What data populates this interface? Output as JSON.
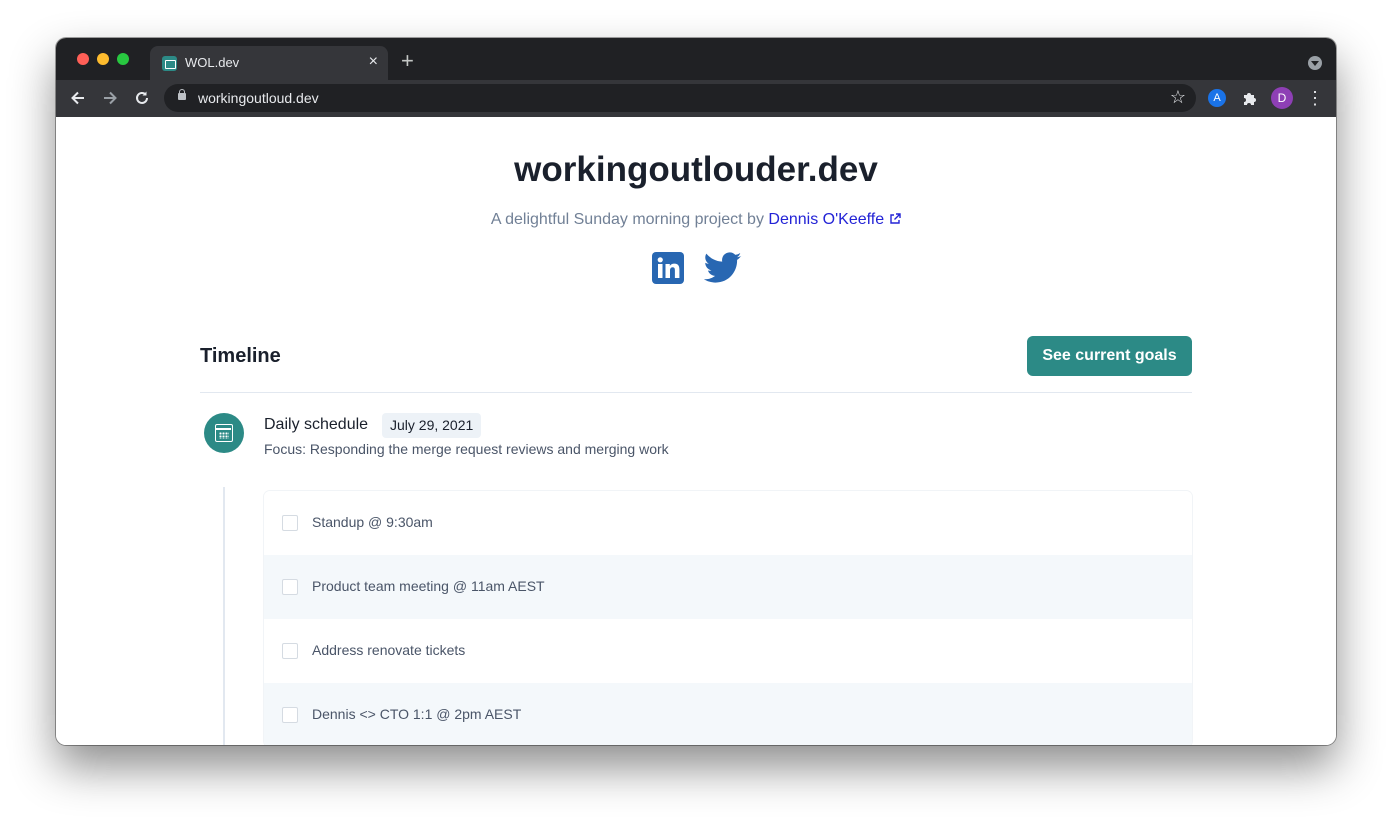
{
  "browser": {
    "tab_title": "WOL.dev",
    "tab_close": "×",
    "new_tab": "+",
    "url": "workingoutloud.dev",
    "avatar_letter": "D",
    "ext_letter": "A"
  },
  "header": {
    "title": "workingoutlouder.dev",
    "subtitle_prefix": "A delightful Sunday morning project by ",
    "author_name": "Dennis O'Keeffe",
    "social": [
      "linkedin-icon",
      "twitter-icon"
    ],
    "brand_color": "#2c8a86"
  },
  "timeline": {
    "title": "Timeline",
    "goals_button": "See current goals",
    "event": {
      "icon": "calendar-icon",
      "title": "Daily schedule",
      "date": "July 29, 2021",
      "focus": "Focus: Responding the merge request reviews and merging work",
      "tasks": [
        {
          "label": "Standup @ 9:30am",
          "checked": false
        },
        {
          "label": "Product team meeting @ 11am AEST",
          "checked": false
        },
        {
          "label": "Address renovate tickets",
          "checked": false
        },
        {
          "label": "Dennis <> CTO 1:1 @ 2pm AEST",
          "checked": false
        }
      ]
    }
  }
}
